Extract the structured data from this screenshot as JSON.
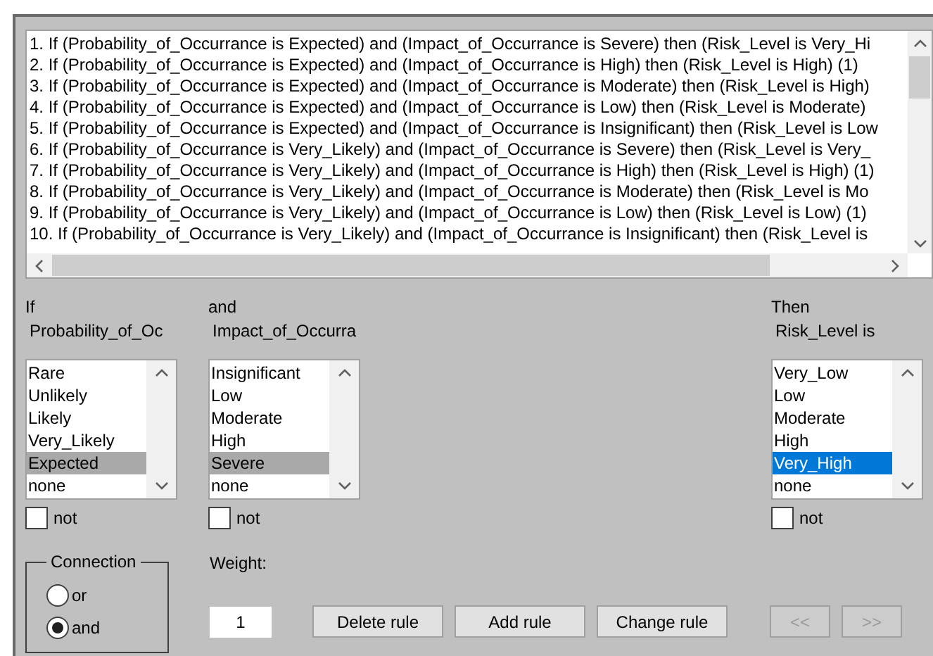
{
  "rules": [
    {
      "text": "1. If (Probability_of_Occurrance is Expected) and (Impact_of_Occurrance is Severe) then (Risk_Level is Very_Hi"
    },
    {
      "text": "2. If (Probability_of_Occurrance is Expected) and (Impact_of_Occurrance is High) then (Risk_Level is High) (1)"
    },
    {
      "text": "3. If (Probability_of_Occurrance is Expected) and (Impact_of_Occurrance is Moderate) then (Risk_Level is High)"
    },
    {
      "text": "4. If (Probability_of_Occurrance is Expected) and (Impact_of_Occurrance is Low) then (Risk_Level is Moderate)"
    },
    {
      "text": "5. If (Probability_of_Occurrance is Expected) and (Impact_of_Occurrance is Insignificant) then (Risk_Level is Low"
    },
    {
      "text": "6. If (Probability_of_Occurrance is Very_Likely) and (Impact_of_Occurrance is Severe) then (Risk_Level is Very_"
    },
    {
      "text": "7. If (Probability_of_Occurrance is Very_Likely) and (Impact_of_Occurrance is High) then (Risk_Level is High) (1)"
    },
    {
      "text": "8. If (Probability_of_Occurrance is Very_Likely) and (Impact_of_Occurrance is Moderate) then (Risk_Level is Mo"
    },
    {
      "text": "9. If (Probability_of_Occurrance is Very_Likely) and (Impact_of_Occurrance is Low) then (Risk_Level is Low) (1)"
    },
    {
      "text": "10. If (Probability_of_Occurrance is Very_Likely) and (Impact_of_Occurrance is Insignificant) then (Risk_Level is"
    }
  ],
  "inputs": [
    {
      "header": "If",
      "variable": "Probability_of_Oc",
      "focused": false,
      "not_checked": false,
      "not_label": "not",
      "options": [
        {
          "label": "Rare",
          "selected": false
        },
        {
          "label": "Unlikely",
          "selected": false
        },
        {
          "label": "Likely",
          "selected": false
        },
        {
          "label": "Very_Likely",
          "selected": false
        },
        {
          "label": "Expected",
          "selected": true
        },
        {
          "label": "none",
          "selected": false
        }
      ]
    },
    {
      "header": "and",
      "variable": "Impact_of_Occurra",
      "focused": false,
      "not_checked": false,
      "not_label": "not",
      "options": [
        {
          "label": "Insignificant",
          "selected": false
        },
        {
          "label": "Low",
          "selected": false
        },
        {
          "label": "Moderate",
          "selected": false
        },
        {
          "label": "High",
          "selected": false
        },
        {
          "label": "Severe",
          "selected": true
        },
        {
          "label": "none",
          "selected": false
        }
      ]
    }
  ],
  "output": {
    "header": "Then",
    "variable": "Risk_Level is",
    "focused": true,
    "not_checked": false,
    "not_label": "not",
    "options": [
      {
        "label": "Very_Low",
        "selected": false
      },
      {
        "label": "Low",
        "selected": false
      },
      {
        "label": "Moderate",
        "selected": false
      },
      {
        "label": "High",
        "selected": false
      },
      {
        "label": "Very_High",
        "selected": true
      },
      {
        "label": "none",
        "selected": false
      }
    ]
  },
  "connection": {
    "title": "Connection",
    "options": [
      {
        "label": "or",
        "selected": false
      },
      {
        "label": "and",
        "selected": true
      }
    ]
  },
  "weight": {
    "label": "Weight:",
    "value": "1"
  },
  "buttons": [
    {
      "label": "Delete rule",
      "disabled": false
    },
    {
      "label": "Add rule",
      "disabled": false
    },
    {
      "label": "Change rule",
      "disabled": false
    }
  ],
  "nav_buttons": [
    {
      "label": "<<",
      "disabled": true
    },
    {
      "label": ">>",
      "disabled": true
    }
  ]
}
